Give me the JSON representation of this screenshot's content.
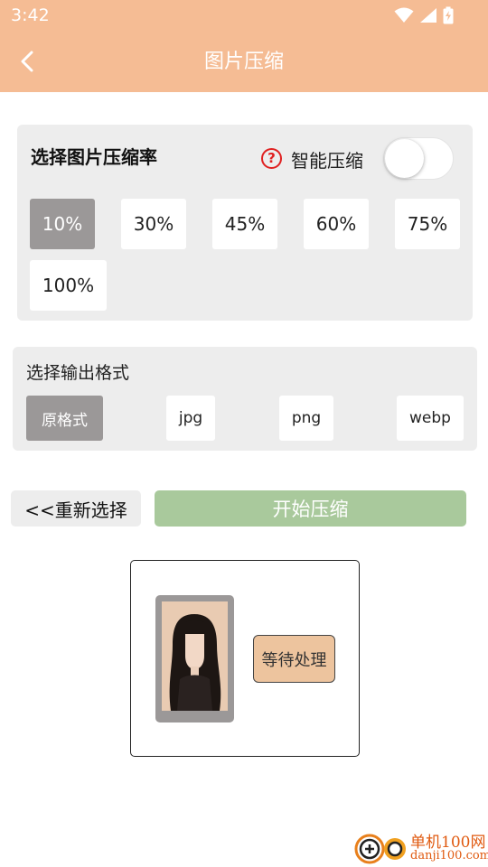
{
  "status_bar": {
    "time": "3:42"
  },
  "header": {
    "title": "图片压缩"
  },
  "compression": {
    "title": "选择图片压缩率",
    "smart_label": "智能压缩",
    "help_glyph": "?",
    "smart_enabled": false,
    "rates": [
      "10%",
      "30%",
      "45%",
      "60%",
      "75%",
      "100%"
    ],
    "selected_rate": "10%"
  },
  "format": {
    "title": "选择输出格式",
    "options": [
      "原格式",
      "jpg",
      "png",
      "webp"
    ],
    "selected": "原格式"
  },
  "actions": {
    "reselect": "<<重新选择",
    "start": "开始压缩"
  },
  "preview": {
    "status": "等待处理"
  },
  "watermark": {
    "line1": "单机100网",
    "line2": "danji100.com"
  },
  "colors": {
    "header_bg": "#f5bc94",
    "start_button": "#a9c99c",
    "selected_option": "#9b9898",
    "status_badge": "#edc49e",
    "watermark": "#e05a10"
  }
}
